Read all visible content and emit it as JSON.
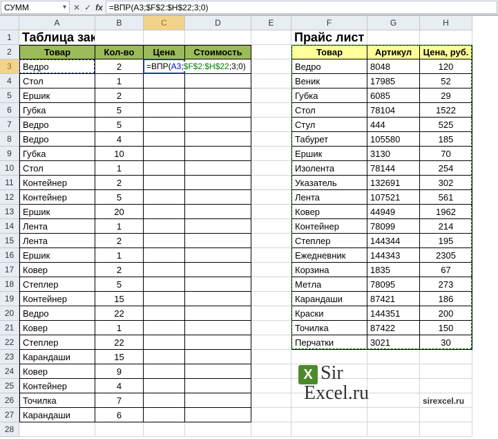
{
  "formula_bar": {
    "name_box": "СУММ",
    "formula": "=ВПР(A3;$F$2:$H$22;3;0)"
  },
  "columns": [
    "A",
    "B",
    "C",
    "D",
    "E",
    "F",
    "G",
    "H"
  ],
  "row_count": 28,
  "titles": {
    "left": "Таблица заказов",
    "right": "Прайс лист"
  },
  "left_headers": [
    "Товар",
    "Кол-во",
    "Цена",
    "Стоимость"
  ],
  "right_headers": [
    "Товар",
    "Артикул",
    "Цена, руб."
  ],
  "orders": [
    [
      "Ведро",
      2
    ],
    [
      "Стол",
      1
    ],
    [
      "Ершик",
      2
    ],
    [
      "Губка",
      5
    ],
    [
      "Ведро",
      5
    ],
    [
      "Ведро",
      4
    ],
    [
      "Губка",
      10
    ],
    [
      "Стол",
      1
    ],
    [
      "Контейнер",
      2
    ],
    [
      "Контейнер",
      5
    ],
    [
      "Ершик",
      20
    ],
    [
      "Лента",
      1
    ],
    [
      "Лента",
      2
    ],
    [
      "Ершик",
      1
    ],
    [
      "Ковер",
      2
    ],
    [
      "Степлер",
      5
    ],
    [
      "Контейнер",
      15
    ],
    [
      "Ведро",
      22
    ],
    [
      "Ковер",
      1
    ],
    [
      "Степлер",
      22
    ],
    [
      "Карандаши",
      15
    ],
    [
      "Ковер",
      9
    ],
    [
      "Контейнер",
      4
    ],
    [
      "Точилка",
      7
    ],
    [
      "Карандаши",
      6
    ]
  ],
  "price": [
    [
      "Ведро",
      "8048",
      120
    ],
    [
      "Веник",
      "17985",
      52
    ],
    [
      "Губка",
      "6085",
      29
    ],
    [
      "Стол",
      "78104",
      1522
    ],
    [
      "Стул",
      "444",
      525
    ],
    [
      "Табурет",
      "105580",
      185
    ],
    [
      "Ершик",
      "3130",
      70
    ],
    [
      "Изолента",
      "78144",
      254
    ],
    [
      "Указатель",
      "132691",
      302
    ],
    [
      "Лента",
      "107521",
      561
    ],
    [
      "Ковер",
      "44949",
      1962
    ],
    [
      "Контейнер",
      "78099",
      214
    ],
    [
      "Степлер",
      "144344",
      195
    ],
    [
      "Ежедневник",
      "144343",
      2305
    ],
    [
      "Корзина",
      "1835",
      67
    ],
    [
      "Метла",
      "78095",
      273
    ],
    [
      "Карандаши",
      "87421",
      186
    ],
    [
      "Краски",
      "144351",
      200
    ],
    [
      "Точилка",
      "87422",
      150
    ],
    [
      "Перчатки",
      "3021",
      30
    ]
  ],
  "active_cell_formula": {
    "pre": "=ВПР(",
    "a": "A3",
    "sep1": ";",
    "b": "$F$2:$H$22",
    "post": ";3;0)"
  },
  "logo": {
    "line1": "Sir",
    "line2": "Excel.ru"
  },
  "site": "sirexcel.ru",
  "chart_data": {
    "type": "table",
    "note": "spreadsheet, no chart"
  }
}
